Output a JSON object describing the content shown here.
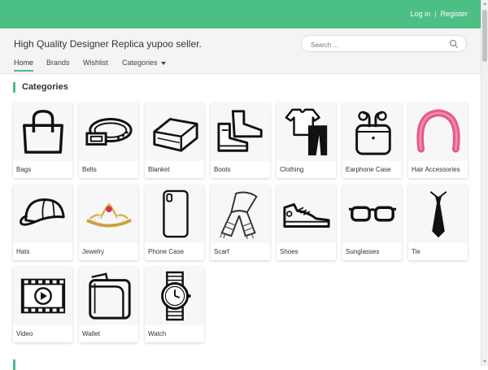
{
  "topbar": {
    "login": "Log in",
    "separator": "|",
    "register": "Register"
  },
  "header": {
    "site_title": "High Quality Designer Replica yupoo seller.",
    "search_placeholder": "Search ...",
    "nav": [
      {
        "label": "Home",
        "active": true
      },
      {
        "label": "Brands"
      },
      {
        "label": "Wishlist"
      },
      {
        "label": "Categories",
        "dropdown": true
      }
    ]
  },
  "section": {
    "title": "Categories"
  },
  "categories": [
    {
      "label": "Bags",
      "icon": "bag-icon"
    },
    {
      "label": "Belts",
      "icon": "belt-icon"
    },
    {
      "label": "Blanket",
      "icon": "blanket-icon"
    },
    {
      "label": "Boots",
      "icon": "boots-icon"
    },
    {
      "label": "Clothing",
      "icon": "clothing-icon"
    },
    {
      "label": "Earphone Case",
      "icon": "earphone-case-icon"
    },
    {
      "label": "Hair Accessories",
      "icon": "headband-icon"
    },
    {
      "label": "Hats",
      "icon": "cap-icon"
    },
    {
      "label": "Jewelry",
      "icon": "tiara-icon"
    },
    {
      "label": "Phone Case",
      "icon": "phone-case-icon"
    },
    {
      "label": "Scarf",
      "icon": "scarf-icon"
    },
    {
      "label": "Shoes",
      "icon": "sneaker-icon"
    },
    {
      "label": "Sunglasses",
      "icon": "sunglasses-icon"
    },
    {
      "label": "Tie",
      "icon": "tie-icon"
    },
    {
      "label": "Video",
      "icon": "video-icon"
    },
    {
      "label": "Wallet",
      "icon": "wallet-icon"
    },
    {
      "label": "Watch",
      "icon": "watch-icon"
    }
  ],
  "colors": {
    "accent": "#4bbf84"
  }
}
